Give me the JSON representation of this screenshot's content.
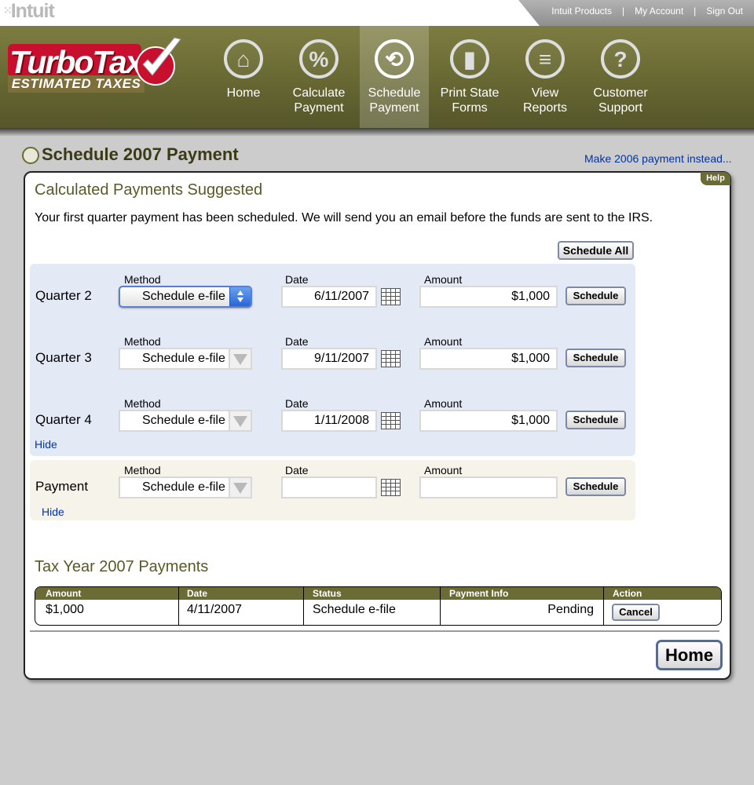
{
  "brand": {
    "intuit": "Intuit",
    "product": "TurboTax",
    "product_sub": "ESTIMATED TAXES"
  },
  "util_nav": [
    "Intuit Products",
    "My Account",
    "Sign Out"
  ],
  "nav": [
    {
      "id": "home",
      "label1": "Home",
      "label2": "",
      "icon": "home-icon",
      "glyph": "⌂"
    },
    {
      "id": "calculate",
      "label1": "Calculate",
      "label2": "Payment",
      "icon": "percent-icon",
      "glyph": "%"
    },
    {
      "id": "schedule",
      "label1": "Schedule",
      "label2": "Payment",
      "icon": "schedule-icon",
      "glyph": "⟲",
      "active": true
    },
    {
      "id": "print-state",
      "label1": "Print State",
      "label2": "Forms",
      "icon": "state-map-icon",
      "glyph": "▮"
    },
    {
      "id": "reports",
      "label1": "View",
      "label2": "Reports",
      "icon": "list-icon",
      "glyph": "≡"
    },
    {
      "id": "support",
      "label1": "Customer",
      "label2": "Support",
      "icon": "question-icon",
      "glyph": "?"
    }
  ],
  "page": {
    "title": "Schedule 2007 Payment",
    "alt_link": "Make 2006 payment instead...",
    "help": "Help"
  },
  "calc": {
    "heading": "Calculated Payments Suggested",
    "info": "Your first quarter payment has been scheduled.  We will send you an email before the funds are sent to the IRS.",
    "schedule_all": "Schedule All",
    "col_method": "Method",
    "col_date": "Date",
    "col_amount": "Amount",
    "schedule_label": "Schedule",
    "hide": "Hide",
    "rows": [
      {
        "label": "Quarter 2",
        "method": "Schedule e-file",
        "date": "6/11/2007",
        "amount": "$1,000"
      },
      {
        "label": "Quarter 3",
        "method": "Schedule e-file",
        "date": "9/11/2007",
        "amount": "$1,000"
      },
      {
        "label": "Quarter 4",
        "method": "Schedule e-file",
        "date": "1/11/2008",
        "amount": "$1,000"
      }
    ],
    "payment": {
      "label": "Payment",
      "method": "Schedule e-file",
      "date": "",
      "amount": ""
    }
  },
  "payments": {
    "heading": "Tax Year 2007 Payments",
    "columns": [
      "Amount",
      "Date",
      "Status",
      "Payment Info",
      "Action"
    ],
    "rows": [
      {
        "amount": "$1,000",
        "date": "4/11/2007",
        "status": "Schedule e-file",
        "info": "Pending",
        "action": "Cancel"
      }
    ]
  },
  "home_button": "Home",
  "colors": {
    "olive": "#6b6b35",
    "link": "#0033aa",
    "red": "#c8102e"
  }
}
